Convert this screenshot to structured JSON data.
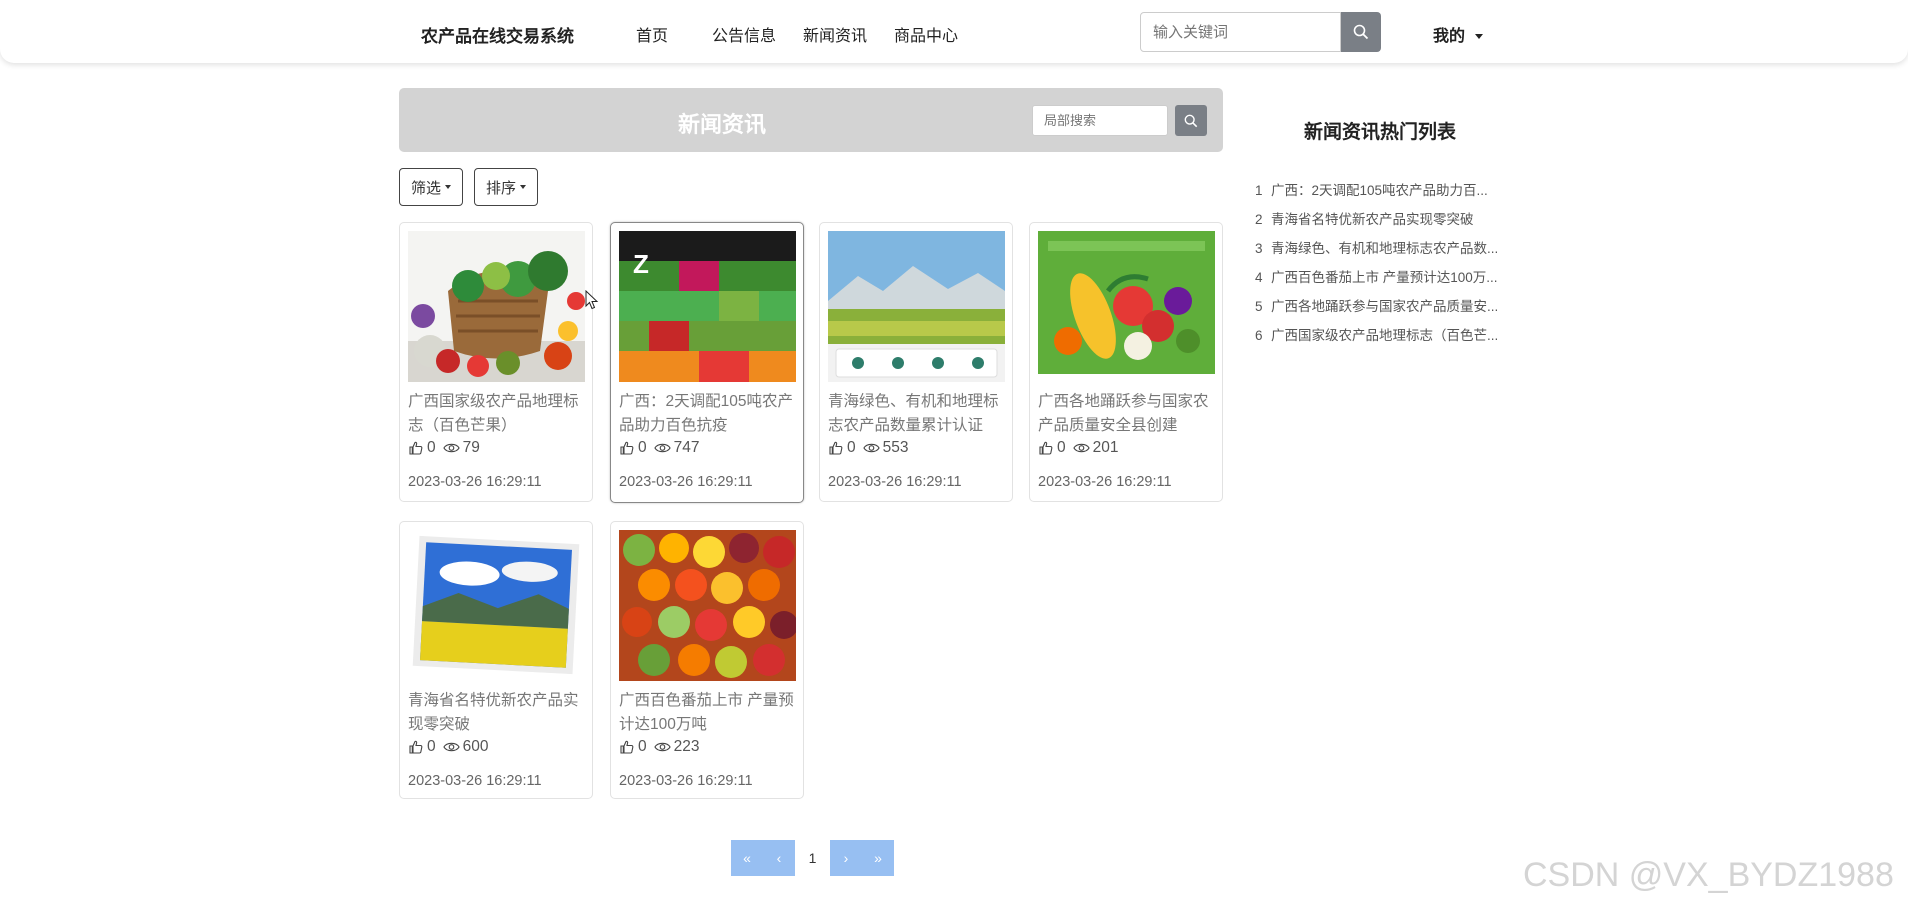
{
  "header": {
    "brand": "农产品在线交易系统",
    "nav": [
      "首页",
      "公告信息",
      "新闻资讯",
      "商品中心"
    ],
    "search_placeholder": "输入关键词",
    "user_menu": "我的"
  },
  "section": {
    "title": "新闻资讯",
    "search_placeholder": "局部搜索",
    "filter_label": "筛选",
    "sort_label": "排序"
  },
  "cards": [
    {
      "title": "广西国家级农产品地理标志（百色芒果）",
      "likes": "0",
      "views": "79",
      "date": "2023-03-26 16:29:11"
    },
    {
      "title": "广西：2天调配105吨农产品助力百色抗疫",
      "likes": "0",
      "views": "747",
      "date": "2023-03-26 16:29:11"
    },
    {
      "title": "青海绿色、有机和地理标志农产品数量累计认证",
      "likes": "0",
      "views": "553",
      "date": "2023-03-26 16:29:11"
    },
    {
      "title": "广西各地踊跃参与国家农产品质量安全县创建",
      "likes": "0",
      "views": "201",
      "date": "2023-03-26 16:29:11"
    },
    {
      "title": "青海省名特优新农产品实现零突破",
      "likes": "0",
      "views": "600",
      "date": "2023-03-26 16:29:11"
    },
    {
      "title": "广西百色番茄上市 产量预计达100万吨",
      "likes": "0",
      "views": "223",
      "date": "2023-03-26 16:29:11"
    }
  ],
  "hot": {
    "title": "新闻资讯热门列表",
    "items": [
      {
        "num": "1",
        "text": "广西：2天调配105吨农产品助力百..."
      },
      {
        "num": "2",
        "text": "青海省名特优新农产品实现零突破"
      },
      {
        "num": "3",
        "text": "青海绿色、有机和地理标志农产品数..."
      },
      {
        "num": "4",
        "text": "广西百色番茄上市 产量预计达100万..."
      },
      {
        "num": "5",
        "text": "广西各地踊跃参与国家农产品质量安..."
      },
      {
        "num": "6",
        "text": "广西国家级农产品地理标志（百色芒..."
      }
    ]
  },
  "pagination": {
    "first": "«",
    "prev": "‹",
    "current": "1",
    "next": "›",
    "last": "»"
  },
  "watermark": "CSDN @VX_BYDZ1988",
  "colors": {
    "header_bg": "#d3d3d3",
    "search_btn": "#7a7f86",
    "pager_btn": "#97bff2"
  }
}
